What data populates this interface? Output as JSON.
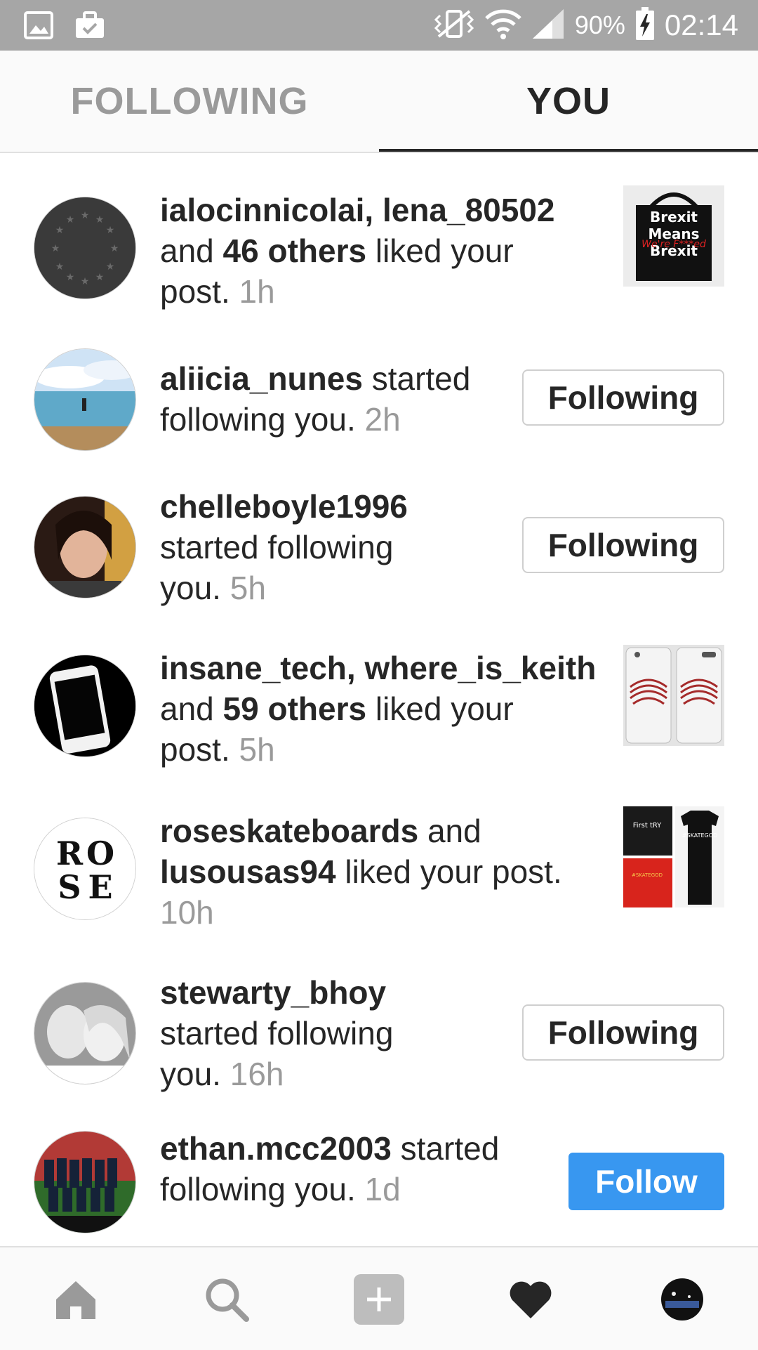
{
  "status_bar": {
    "battery": "90%",
    "time": "02:14",
    "icons": [
      "image-icon",
      "briefcase-icon",
      "vibrate-icon",
      "wifi-icon",
      "signal-icon",
      "battery-charging-icon"
    ]
  },
  "tabs": [
    {
      "label": "FOLLOWING",
      "active": false
    },
    {
      "label": "YOU",
      "active": true
    }
  ],
  "notifications": [
    {
      "type": "like",
      "avatar": "eu-flag-avatar",
      "names": "ialocinnicolai, lena_80502",
      "l1_rest": "",
      "l2_pre": "and ",
      "l2_bold": "46 others",
      "l2_rest": " liked your",
      "l3_text": "post. ",
      "time": "1h",
      "thumb": "brexit-bag-thumbnail"
    },
    {
      "type": "follow",
      "user": "aliicia_nunes",
      "l1_rest": " started",
      "l2_text": "following you. ",
      "time": "2h",
      "button": "Following"
    },
    {
      "type": "follow",
      "user": "chelleboyle1996",
      "l2_text": "started following",
      "l3_text": "you. ",
      "time": "5h",
      "button": "Following"
    },
    {
      "type": "like",
      "names": "insane_tech, where_is_keith",
      "l2_pre": "and ",
      "l2_bold": "59 others",
      "l2_rest": " liked your",
      "l3_text": "post. ",
      "time": "5h",
      "thumb": "phone-case-thumbnail"
    },
    {
      "type": "like",
      "user1": "roseskateboards",
      "l1_rest": " and",
      "user2": "lusousas94",
      "l2_rest": " liked your post.",
      "time": "10h",
      "thumb": "tshirts-thumbnail"
    },
    {
      "type": "follow",
      "user": "stewarty_bhoy",
      "l2_text": "started following",
      "l3_text": "you. ",
      "time": "16h",
      "button": "Following"
    },
    {
      "type": "follow",
      "user": "ethan.mcc2003",
      "l1_rest": " started",
      "l2_text": "following you. ",
      "time": "1d",
      "button": "Follow"
    }
  ],
  "bottom_nav": [
    "home-icon",
    "search-icon",
    "add-post-icon",
    "activity-heart-icon",
    "profile-avatar"
  ],
  "colors": {
    "accent": "#3897f0",
    "status_bar": "#a6a6a6",
    "muted_text": "#9a9a9a"
  }
}
